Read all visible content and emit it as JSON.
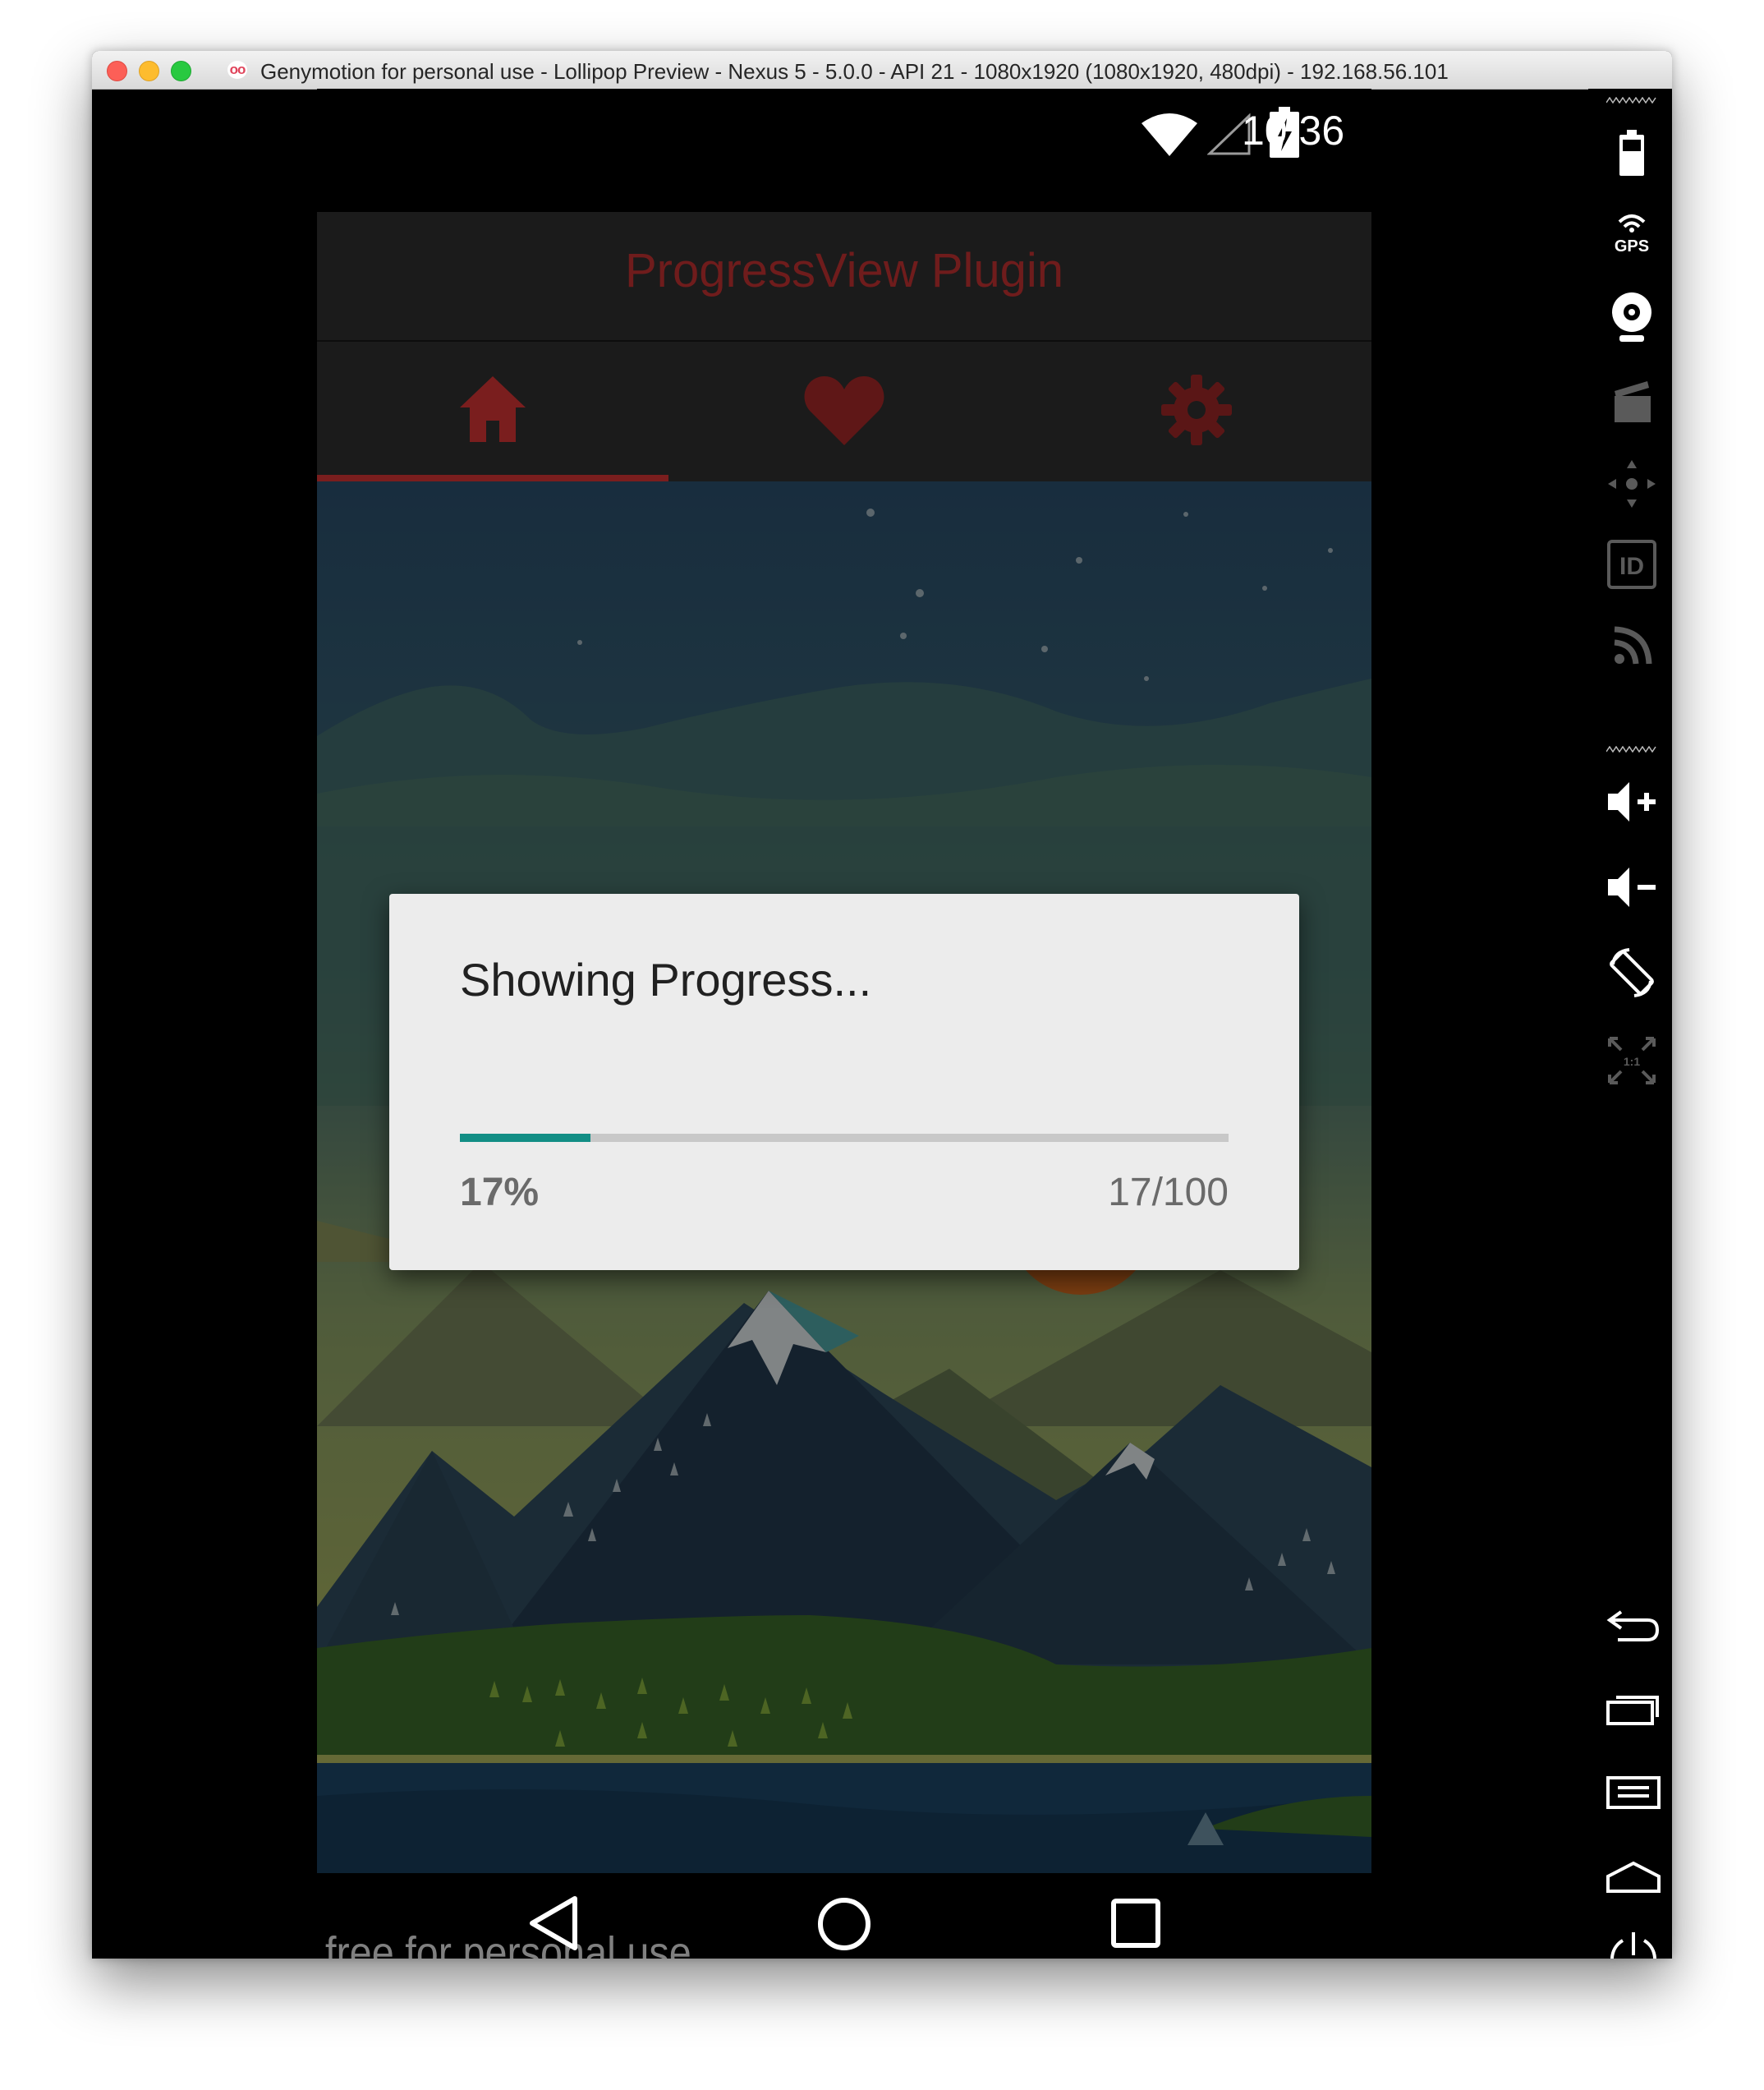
{
  "window": {
    "title": "Genymotion for personal use - Lollipop Preview - Nexus 5 - 5.0.0 - API 21 - 1080x1920 (1080x1920, 480dpi) - 192.168.56.101"
  },
  "statusbar": {
    "time": "10:36"
  },
  "app": {
    "title": "ProgressView Plugin",
    "tabs": [
      {
        "icon": "home-icon",
        "selected": true
      },
      {
        "icon": "heart-icon",
        "selected": false
      },
      {
        "icon": "gear-icon",
        "selected": false
      }
    ],
    "accent_color": "#7a1e1e"
  },
  "dialog": {
    "title": "Showing Progress...",
    "progress_fraction": 0.17,
    "percent_label": "17%",
    "count_label": "17/100",
    "progress_color": "#128e85"
  },
  "navbar": {
    "watermark": "free for personal use"
  },
  "sidebar": {
    "gps_label": "GPS",
    "id_label": "ID",
    "pixel_label": "1:1"
  }
}
